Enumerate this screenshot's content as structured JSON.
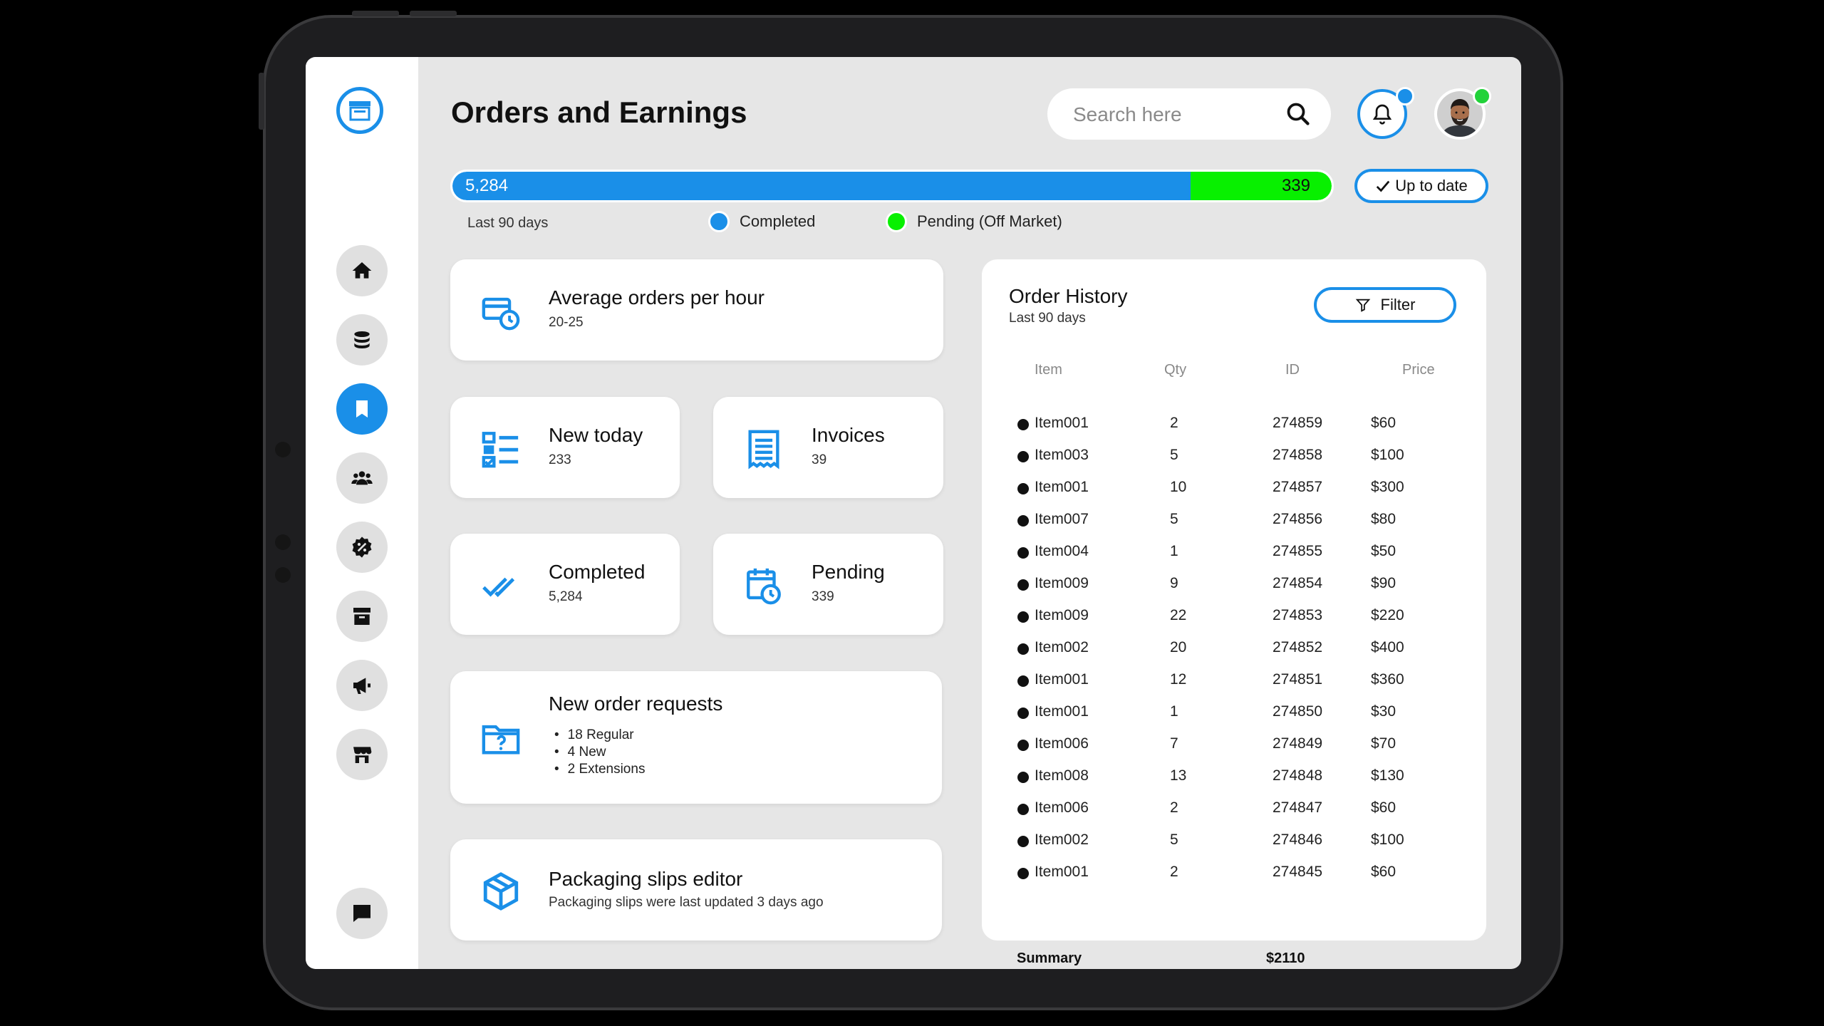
{
  "page": {
    "title": "Orders and Earnings"
  },
  "search": {
    "placeholder": "Search here"
  },
  "progress": {
    "completed_value": "5,284",
    "pending_value": "339",
    "completed_fraction": 0.8397,
    "status_label": "Up to date",
    "period_label": "Last 90 days",
    "legend_completed": "Completed",
    "legend_pending": "Pending (Off Market)"
  },
  "colors": {
    "accent": "#1a8fe8",
    "pending": "#08f000",
    "online": "#22d23a"
  },
  "sidebar": {
    "items": [
      {
        "icon": "home-icon"
      },
      {
        "icon": "database-icon"
      },
      {
        "icon": "bookmark-icon",
        "active": true
      },
      {
        "icon": "users-icon"
      },
      {
        "icon": "discount-badge-icon"
      },
      {
        "icon": "archive-icon"
      },
      {
        "icon": "megaphone-icon"
      },
      {
        "icon": "storefront-icon"
      }
    ],
    "bottom_icon": "chat-icon"
  },
  "cards": {
    "avg_orders": {
      "title": "Average orders per hour",
      "value": "20-25",
      "icon": "card-clock-icon"
    },
    "new_today": {
      "title": "New today",
      "value": "233",
      "icon": "checklist-icon"
    },
    "invoices": {
      "title": "Invoices",
      "value": "39",
      "icon": "invoice-icon"
    },
    "completed": {
      "title": "Completed",
      "value": "5,284",
      "icon": "double-check-icon"
    },
    "pending": {
      "title": "Pending",
      "value": "339",
      "icon": "calendar-clock-icon"
    },
    "new_requests": {
      "title": "New order requests",
      "items": [
        "18 Regular",
        "4 New",
        "2 Extensions"
      ],
      "icon": "folder-question-icon"
    },
    "packaging": {
      "title": "Packaging slips editor",
      "subtitle": "Packaging slips were last updated 3 days ago",
      "icon": "package-icon"
    }
  },
  "history": {
    "title": "Order History",
    "subtitle": "Last 90 days",
    "filter_label": "Filter",
    "columns": [
      "Item",
      "Qty",
      "ID",
      "Price"
    ],
    "rows": [
      [
        "Item001",
        "2",
        "274859",
        "$60"
      ],
      [
        "Item003",
        "5",
        "274858",
        "$100"
      ],
      [
        "Item001",
        "10",
        "274857",
        "$300"
      ],
      [
        "Item007",
        "5",
        "274856",
        "$80"
      ],
      [
        "Item004",
        "1",
        "274855",
        "$50"
      ],
      [
        "Item009",
        "9",
        "274854",
        "$90"
      ],
      [
        "Item009",
        "22",
        "274853",
        "$220"
      ],
      [
        "Item002",
        "20",
        "274852",
        "$400"
      ],
      [
        "Item001",
        "12",
        "274851",
        "$360"
      ],
      [
        "Item001",
        "1",
        "274850",
        "$30"
      ],
      [
        "Item006",
        "7",
        "274849",
        "$70"
      ],
      [
        "Item008",
        "13",
        "274848",
        "$130"
      ],
      [
        "Item006",
        "2",
        "274847",
        "$60"
      ],
      [
        "Item002",
        "5",
        "274846",
        "$100"
      ],
      [
        "Item001",
        "2",
        "274845",
        "$60"
      ]
    ],
    "summary_label": "Summary",
    "summary_value": "$2110"
  }
}
